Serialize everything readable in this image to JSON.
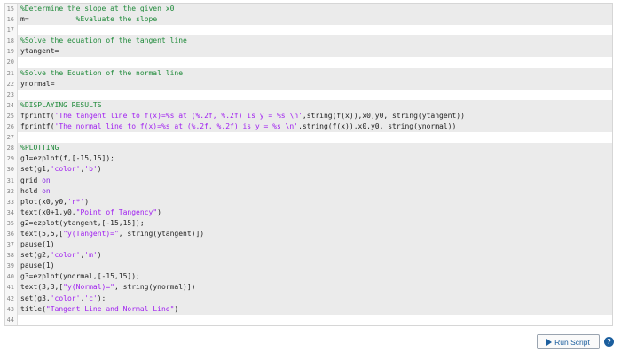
{
  "editor": {
    "lines": [
      {
        "num": "15",
        "shaded": true,
        "parts": [
          [
            "comment",
            "%Determine the slope at the given x0"
          ]
        ]
      },
      {
        "num": "16",
        "shaded": true,
        "parts": [
          [
            "text",
            "m=           "
          ],
          [
            "comment",
            "%Evaluate the slope"
          ]
        ]
      },
      {
        "num": "17",
        "shaded": false,
        "parts": []
      },
      {
        "num": "18",
        "shaded": true,
        "parts": [
          [
            "comment",
            "%Solve the equation of the tangent line"
          ]
        ]
      },
      {
        "num": "19",
        "shaded": true,
        "parts": [
          [
            "text",
            "ytangent="
          ]
        ]
      },
      {
        "num": "20",
        "shaded": false,
        "parts": []
      },
      {
        "num": "21",
        "shaded": true,
        "parts": [
          [
            "comment",
            "%Solve the Equation of the normal line"
          ]
        ]
      },
      {
        "num": "22",
        "shaded": true,
        "parts": [
          [
            "text",
            "ynormal="
          ]
        ]
      },
      {
        "num": "23",
        "shaded": false,
        "parts": []
      },
      {
        "num": "24",
        "shaded": true,
        "parts": [
          [
            "comment",
            "%DISPLAYING RESULTS"
          ]
        ]
      },
      {
        "num": "25",
        "shaded": true,
        "parts": [
          [
            "text",
            "fprintf("
          ],
          [
            "string",
            "'The tangent line to f(x)=%s at (%.2f, %.2f) is y = %s \\n'"
          ],
          [
            "text",
            ",string(f(x)),x0,y0, string(ytangent))"
          ]
        ]
      },
      {
        "num": "26",
        "shaded": true,
        "parts": [
          [
            "text",
            "fprintf("
          ],
          [
            "string",
            "'The normal line to f(x)=%s at (%.2f, %.2f) is y = %s \\n'"
          ],
          [
            "text",
            ",string(f(x)),x0,y0, string(ynormal))"
          ]
        ]
      },
      {
        "num": "27",
        "shaded": false,
        "parts": []
      },
      {
        "num": "28",
        "shaded": true,
        "parts": [
          [
            "comment",
            "%PLOTTING"
          ]
        ]
      },
      {
        "num": "29",
        "shaded": true,
        "parts": [
          [
            "text",
            "g1=ezplot(f,[-15,15]);"
          ]
        ]
      },
      {
        "num": "30",
        "shaded": true,
        "parts": [
          [
            "text",
            "set(g1,"
          ],
          [
            "string",
            "'color'"
          ],
          [
            "text",
            ","
          ],
          [
            "string",
            "'b'"
          ],
          [
            "text",
            ")"
          ]
        ]
      },
      {
        "num": "31",
        "shaded": true,
        "parts": [
          [
            "text",
            "grid "
          ],
          [
            "keyword",
            "on"
          ]
        ]
      },
      {
        "num": "32",
        "shaded": true,
        "parts": [
          [
            "text",
            "hold "
          ],
          [
            "keyword",
            "on"
          ]
        ]
      },
      {
        "num": "33",
        "shaded": true,
        "parts": [
          [
            "text",
            "plot(x0,y0,"
          ],
          [
            "string",
            "'r*'"
          ],
          [
            "text",
            ")"
          ]
        ]
      },
      {
        "num": "34",
        "shaded": true,
        "parts": [
          [
            "text",
            "text(x0+1,y0,"
          ],
          [
            "string",
            "\"Point of Tangency\""
          ],
          [
            "text",
            ")"
          ]
        ]
      },
      {
        "num": "35",
        "shaded": true,
        "parts": [
          [
            "text",
            "g2=ezplot(ytangent,[-15,15]);"
          ]
        ]
      },
      {
        "num": "36",
        "shaded": true,
        "parts": [
          [
            "text",
            "text(5,5,["
          ],
          [
            "string",
            "\"y(Tangent)=\""
          ],
          [
            "text",
            ", string(ytangent)])"
          ]
        ]
      },
      {
        "num": "37",
        "shaded": true,
        "parts": [
          [
            "text",
            "pause(1)"
          ]
        ]
      },
      {
        "num": "38",
        "shaded": true,
        "parts": [
          [
            "text",
            "set(g2,"
          ],
          [
            "string",
            "'color'"
          ],
          [
            "text",
            ","
          ],
          [
            "string",
            "'m'"
          ],
          [
            "text",
            ")"
          ]
        ]
      },
      {
        "num": "39",
        "shaded": true,
        "parts": [
          [
            "text",
            "pause(1)"
          ]
        ]
      },
      {
        "num": "40",
        "shaded": true,
        "parts": [
          [
            "text",
            "g3=ezplot(ynormal,[-15,15]);"
          ]
        ]
      },
      {
        "num": "41",
        "shaded": true,
        "parts": [
          [
            "text",
            "text(3,3,["
          ],
          [
            "string",
            "\"y(Normal)=\""
          ],
          [
            "text",
            ", string(ynormal)])"
          ]
        ]
      },
      {
        "num": "42",
        "shaded": true,
        "parts": [
          [
            "text",
            "set(g3,"
          ],
          [
            "string",
            "'color'"
          ],
          [
            "text",
            ","
          ],
          [
            "string",
            "'c'"
          ],
          [
            "text",
            ");"
          ]
        ]
      },
      {
        "num": "43",
        "shaded": true,
        "parts": [
          [
            "text",
            "title("
          ],
          [
            "string",
            "\"Tangent Line and Normal Line\""
          ],
          [
            "text",
            ")"
          ]
        ]
      },
      {
        "num": "44",
        "shaded": false,
        "parts": []
      }
    ]
  },
  "toolbar": {
    "run_label": "Run Script",
    "help_glyph": "?"
  },
  "colors": {
    "comment": "#1f8a3a",
    "string": "#a020f0",
    "keyword": "#8a2be2",
    "accent": "#1b5e9e"
  }
}
